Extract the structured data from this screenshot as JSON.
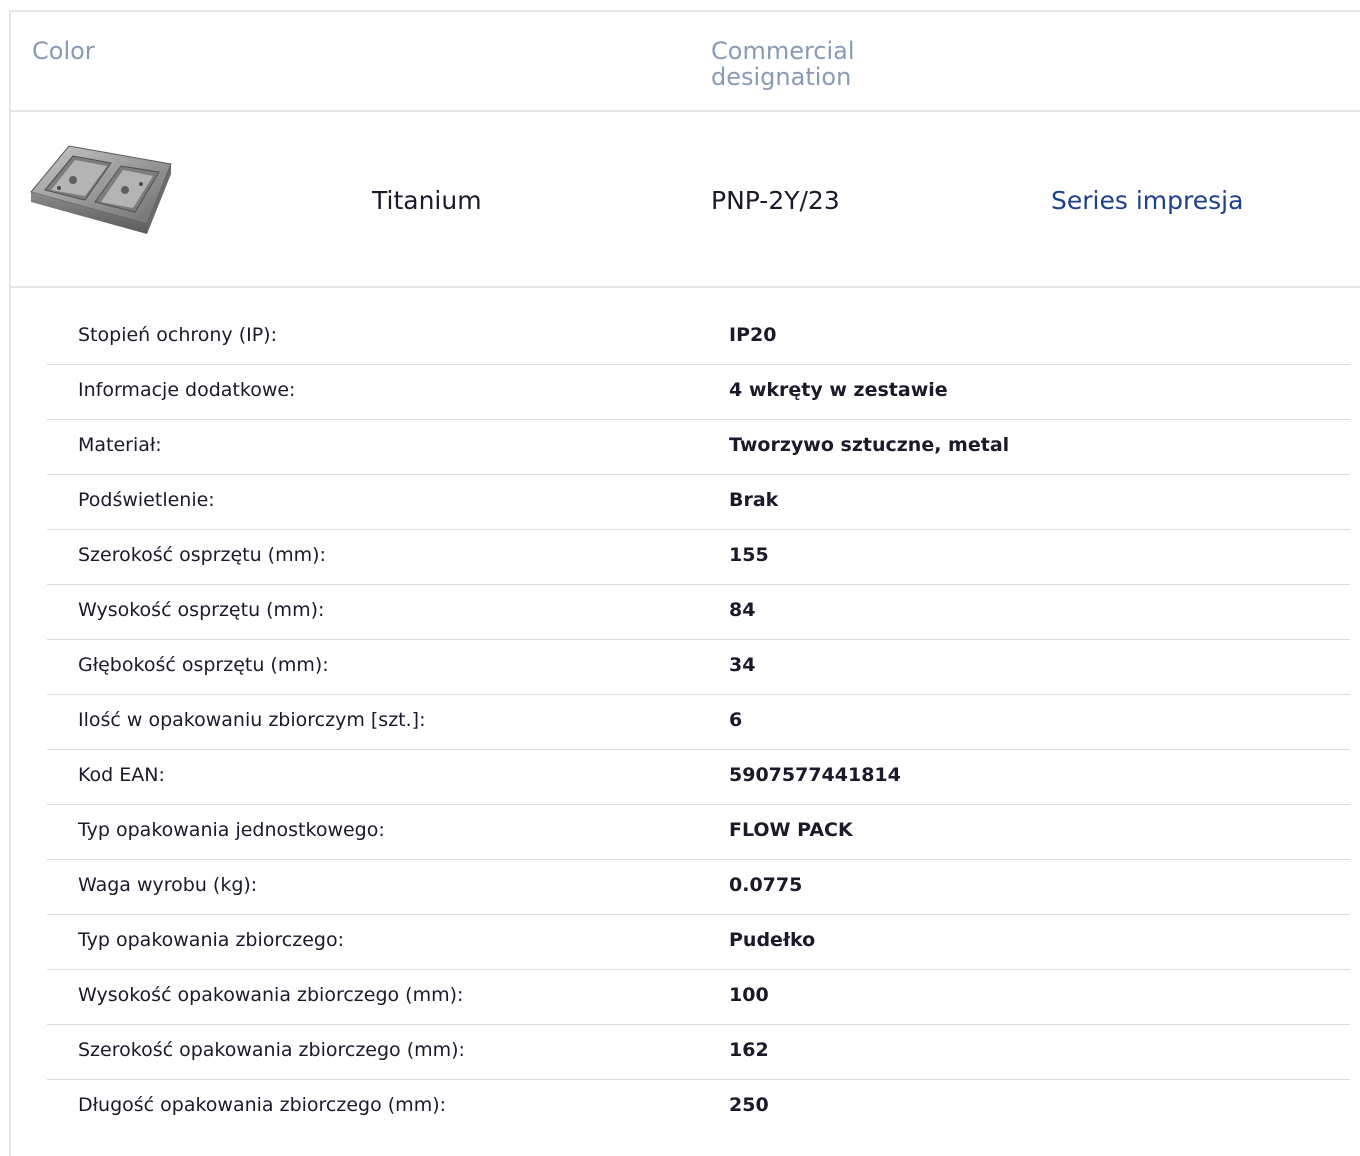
{
  "header": {
    "color_label": "Color",
    "commercial_label": "Commercial designation"
  },
  "product": {
    "image_icon": "double-flush-box-image",
    "color": "Titanium",
    "designation": "PNP-2Y/23",
    "series_link": "Series impresja"
  },
  "specs": [
    {
      "label": "Stopień ochrony (IP):",
      "value": "IP20"
    },
    {
      "label": "Informacje dodatkowe:",
      "value": "4 wkręty w zestawie"
    },
    {
      "label": "Materiał:",
      "value": "Tworzywo sztuczne, metal"
    },
    {
      "label": "Podświetlenie:",
      "value": "Brak"
    },
    {
      "label": "Szerokość osprzętu (mm):",
      "value": "155"
    },
    {
      "label": "Wysokość osprzętu (mm):",
      "value": "84"
    },
    {
      "label": "Głębokość osprzętu (mm):",
      "value": "34"
    },
    {
      "label": "Ilość w opakowaniu zbiorczym [szt.]:",
      "value": "6"
    },
    {
      "label": "Kod EAN:",
      "value": "5907577441814"
    },
    {
      "label": "Typ opakowania jednostkowego:",
      "value": "FLOW PACK"
    },
    {
      "label": "Waga wyrobu (kg):",
      "value": "0.0775"
    },
    {
      "label": "Typ opakowania zbiorczego:",
      "value": "Pudełko"
    },
    {
      "label": "Wysokość opakowania zbiorczego (mm):",
      "value": "100"
    },
    {
      "label": "Szerokość opakowania zbiorczego (mm):",
      "value": "162"
    },
    {
      "label": "Długość opakowania zbiorczego (mm):",
      "value": "250"
    }
  ],
  "colors": {
    "header_text": "#8a9ab4",
    "link": "#1e3f8a",
    "text": "#1a1a2a",
    "border": "#e6e6e6"
  }
}
